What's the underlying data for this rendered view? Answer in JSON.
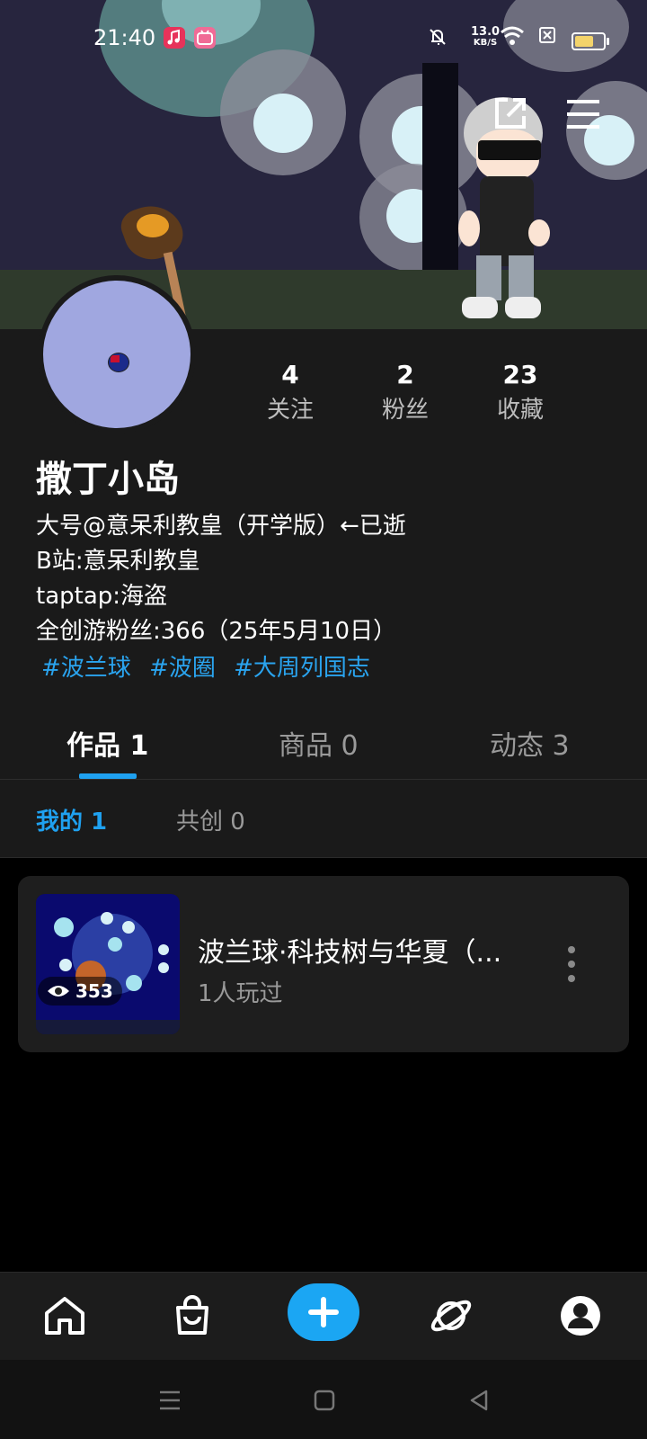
{
  "status_bar": {
    "time": "21:40",
    "net_speed_value": "13.0",
    "net_speed_unit": "KB/S",
    "battery_level": 0.65
  },
  "header": {
    "share_icon": "share-icon",
    "menu_icon": "menu-icon"
  },
  "profile": {
    "stats": [
      {
        "value": "4",
        "label": "关注"
      },
      {
        "value": "2",
        "label": "粉丝"
      },
      {
        "value": "23",
        "label": "收藏"
      }
    ],
    "name": "撒丁小岛",
    "bio": [
      "大号@意呆利教皇（开学版）←已逝",
      "B站:意呆利教皇",
      "taptap:海盗",
      "全创游粉丝:366（25年5月10日）"
    ],
    "tags": [
      "#波兰球",
      "#波圈",
      "#大周列国志"
    ]
  },
  "tabs": [
    {
      "label": "作品 1"
    },
    {
      "label": "商品 0"
    },
    {
      "label": "动态 3"
    }
  ],
  "subtabs": [
    {
      "label": "我的 1"
    },
    {
      "label": "共创 0"
    }
  ],
  "works": [
    {
      "title": "波兰球·科技树与华夏（...",
      "played": "1人玩过",
      "views": "353"
    }
  ],
  "bottom_nav": [
    "home-icon",
    "shop-icon",
    "add-icon",
    "planet-icon",
    "profile-icon"
  ],
  "colors": {
    "accent": "#1fa1f0",
    "background": "#1a1a1a"
  }
}
